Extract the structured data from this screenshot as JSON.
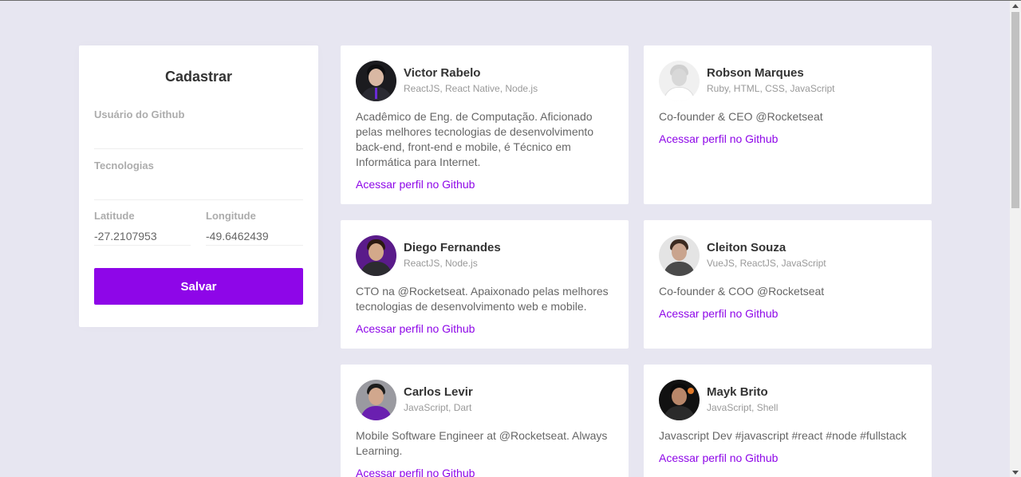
{
  "form": {
    "title": "Cadastrar",
    "github_user_label": "Usuário do Github",
    "github_user_value": "",
    "techs_label": "Tecnologias",
    "techs_value": "",
    "latitude_label": "Latitude",
    "latitude_value": "-27.2107953",
    "longitude_label": "Longitude",
    "longitude_value": "-49.6462439",
    "save_label": "Salvar"
  },
  "devs": [
    {
      "name": "Victor Rabelo",
      "techs": "ReactJS, React Native, Node.js",
      "bio": "Acadêmico de Eng. de Computação. Aficionado pelas melhores tecnologias de desenvolvimento back-end, front-end e mobile, é Técnico em Informática para Internet.",
      "link_label": "Acessar perfil no Github"
    },
    {
      "name": "Robson Marques",
      "techs": "Ruby, HTML, CSS, JavaScript",
      "bio": "Co-founder & CEO @Rocketseat",
      "link_label": "Acessar perfil no Github"
    },
    {
      "name": "Diego Fernandes",
      "techs": "ReactJS, Node.js",
      "bio": "CTO na @Rocketseat. Apaixonado pelas melhores tecnologias de desenvolvimento web e mobile.",
      "link_label": "Acessar perfil no Github"
    },
    {
      "name": "Cleiton Souza",
      "techs": "VueJS, ReactJS, JavaScript",
      "bio": "Co-founder & COO @Rocketseat",
      "link_label": "Acessar perfil no Github"
    },
    {
      "name": "Carlos Levir",
      "techs": "JavaScript, Dart",
      "bio": "Mobile Software Engineer at @Rocketseat. Always Learning.",
      "link_label": "Acessar perfil no Github"
    },
    {
      "name": "Mayk Brito",
      "techs": "JavaScript, Shell",
      "bio": "Javascript Dev #javascript #react #node #fullstack",
      "link_label": "Acessar perfil no Github"
    }
  ],
  "colors": {
    "background": "#e7e6f1",
    "accent": "#8e06e8",
    "card": "#ffffff"
  }
}
